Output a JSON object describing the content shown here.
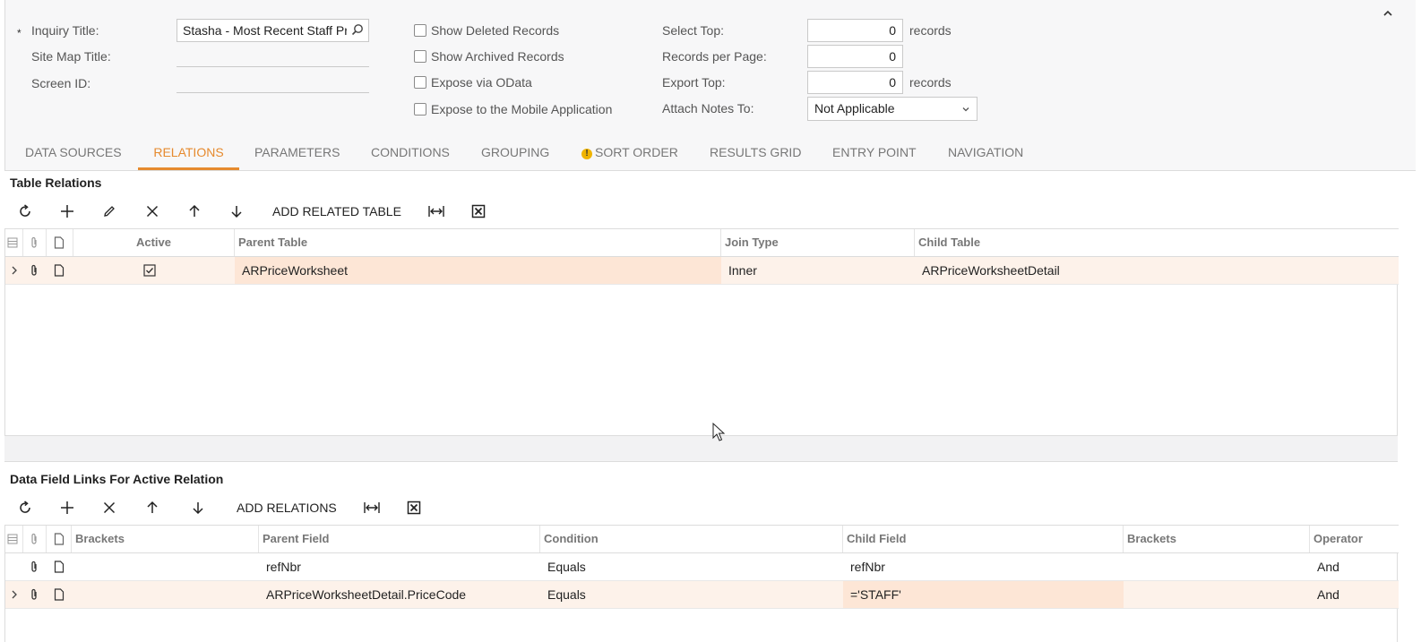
{
  "form": {
    "inquiry_title_label": "Inquiry Title:",
    "inquiry_title_required": "*",
    "inquiry_title_value": "Stasha - Most Recent Staff Pr",
    "site_map_title_label": "Site Map Title:",
    "screen_id_label": "Screen ID:",
    "show_deleted_label": "Show Deleted Records",
    "show_archived_label": "Show Archived Records",
    "expose_odata_label": "Expose via OData",
    "expose_mobile_label": "Expose to the Mobile Application",
    "select_top_label": "Select Top:",
    "select_top_value": "0",
    "select_top_suffix": "records",
    "records_per_page_label": "Records per Page:",
    "records_per_page_value": "0",
    "export_top_label": "Export Top:",
    "export_top_value": "0",
    "export_top_suffix": "records",
    "attach_notes_label": "Attach Notes To:",
    "attach_notes_value": "Not Applicable"
  },
  "tabs": [
    "DATA SOURCES",
    "RELATIONS",
    "PARAMETERS",
    "CONDITIONS",
    "GROUPING",
    "SORT ORDER",
    "RESULTS GRID",
    "ENTRY POINT",
    "NAVIGATION"
  ],
  "active_tab": "RELATIONS",
  "warning_tab": "SORT ORDER",
  "warning_glyph": "!",
  "table_relations": {
    "title": "Table Relations",
    "add_button": "ADD RELATED TABLE",
    "columns": [
      "Active",
      "Parent Table",
      "Join Type",
      "Child Table"
    ],
    "rows": [
      {
        "active": true,
        "parent_table": "ARPriceWorksheet",
        "join_type": "Inner",
        "child_table": "ARPriceWorksheetDetail"
      }
    ]
  },
  "field_links": {
    "title": "Data Field Links For Active Relation",
    "add_button": "ADD RELATIONS",
    "columns": [
      "Brackets",
      "Parent Field",
      "Condition",
      "Child Field",
      "Brackets",
      "Operator"
    ],
    "rows": [
      {
        "brackets_open": "",
        "parent_field": "refNbr",
        "condition": "Equals",
        "child_field": "refNbr",
        "brackets_close": "",
        "operator": "And"
      },
      {
        "brackets_open": "",
        "parent_field": "ARPriceWorksheetDetail.PriceCode",
        "condition": "Equals",
        "child_field": "='STAFF'",
        "brackets_close": "",
        "operator": "And"
      }
    ]
  },
  "colors": {
    "accent": "#e68a2e",
    "selected_row": "#fdf2ea",
    "highlight_cell": "#fde6d6",
    "warning": "#f0b400"
  }
}
